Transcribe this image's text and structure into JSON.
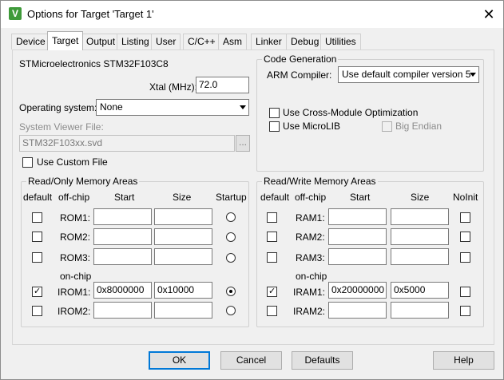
{
  "window": {
    "title": "Options for Target 'Target 1'",
    "close_glyph": "✕",
    "icon_letter": "V"
  },
  "tabs": [
    {
      "label": "Device",
      "active": false
    },
    {
      "label": "Target",
      "active": true
    },
    {
      "label": "Output",
      "active": false
    },
    {
      "label": "Listing",
      "active": false
    },
    {
      "label": "User",
      "active": false
    },
    {
      "label": "C/C++",
      "active": false
    },
    {
      "label": "Asm",
      "active": false
    },
    {
      "label": "Linker",
      "active": false
    },
    {
      "label": "Debug",
      "active": false
    },
    {
      "label": "Utilities",
      "active": false
    }
  ],
  "device": {
    "name": "STMicroelectronics STM32F103C8",
    "xtal_label": "Xtal (MHz):",
    "xtal_value": "72.0",
    "os_label": "Operating system:",
    "os_value": "None",
    "svd_label": "System Viewer File:",
    "svd_value": "STM32F103xx.svd",
    "browse_label": "...",
    "custom_file_label": "Use Custom File"
  },
  "codegen": {
    "title": "Code Generation",
    "compiler_label": "ARM Compiler:",
    "compiler_value": "Use default compiler version 5",
    "cross_module_label": "Use Cross-Module Optimization",
    "microlib_label": "Use MicroLIB",
    "big_endian_label": "Big Endian"
  },
  "rom": {
    "title": "Read/Only Memory Areas",
    "headers": {
      "default": "default",
      "offchip": "off-chip",
      "start": "Start",
      "size": "Size",
      "startup": "Startup"
    },
    "onchip_label": "on-chip",
    "rows": [
      {
        "name": "ROM1:",
        "start": "",
        "size": "",
        "default": false,
        "startup": false
      },
      {
        "name": "ROM2:",
        "start": "",
        "size": "",
        "default": false,
        "startup": false
      },
      {
        "name": "ROM3:",
        "start": "",
        "size": "",
        "default": false,
        "startup": false
      },
      {
        "name": "IROM1:",
        "start": "0x8000000",
        "size": "0x10000",
        "default": true,
        "startup": true
      },
      {
        "name": "IROM2:",
        "start": "",
        "size": "",
        "default": false,
        "startup": false
      }
    ]
  },
  "ram": {
    "title": "Read/Write Memory Areas",
    "headers": {
      "default": "default",
      "offchip": "off-chip",
      "start": "Start",
      "size": "Size",
      "noinit": "NoInit"
    },
    "onchip_label": "on-chip",
    "rows": [
      {
        "name": "RAM1:",
        "start": "",
        "size": "",
        "default": false,
        "noinit": false
      },
      {
        "name": "RAM2:",
        "start": "",
        "size": "",
        "default": false,
        "noinit": false
      },
      {
        "name": "RAM3:",
        "start": "",
        "size": "",
        "default": false,
        "noinit": false
      },
      {
        "name": "IRAM1:",
        "start": "0x20000000",
        "size": "0x5000",
        "default": true,
        "noinit": false
      },
      {
        "name": "IRAM2:",
        "start": "",
        "size": "",
        "default": false,
        "noinit": false
      }
    ]
  },
  "buttons": {
    "ok": "OK",
    "cancel": "Cancel",
    "defaults": "Defaults",
    "help": "Help"
  }
}
